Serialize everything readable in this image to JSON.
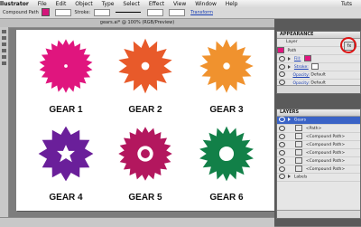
{
  "menubar": {
    "app": "llustrator",
    "items": [
      "File",
      "Edit",
      "Object",
      "Type",
      "Select",
      "Effect",
      "View",
      "Window",
      "Help"
    ],
    "right": "Tuts"
  },
  "control_bar": {
    "selection": "Compound Path",
    "stroke_label": "Stroke:",
    "extra_link": "Transform",
    "fill_color": "#d4147a"
  },
  "document": {
    "tab_title": "gears.ai* @ 100% (RGB/Preview)"
  },
  "gears": [
    {
      "label": "GEAR 1",
      "color": "#e0157e"
    },
    {
      "label": "GEAR 2",
      "color": "#e85a2a"
    },
    {
      "label": "GEAR 3",
      "color": "#f0922e"
    },
    {
      "label": "GEAR 4",
      "color": "#6a1f9a"
    },
    {
      "label": "GEAR 5",
      "color": "#b3175e"
    },
    {
      "label": "GEAR 6",
      "color": "#128048"
    }
  ],
  "appearance_panel": {
    "title": "APPEARANCE",
    "header": "Layer",
    "rows": [
      {
        "label": "Path"
      },
      {
        "label": "Fill:"
      },
      {
        "label": "Stroke:"
      },
      {
        "label": "Opacity:",
        "value": "Default"
      },
      {
        "label": "Opacity:",
        "value": "Default"
      }
    ],
    "fx_label": "fx"
  },
  "layers_panel": {
    "title": "LAYERS",
    "rows": [
      {
        "label": "Gears",
        "selected": true
      },
      {
        "label": "<Path>"
      },
      {
        "label": "<Compound Path>"
      },
      {
        "label": "<Compound Path>"
      },
      {
        "label": "<Compound Path>"
      },
      {
        "label": "<Compound Path>"
      },
      {
        "label": "<Compound Path>"
      },
      {
        "label": "Labels"
      }
    ]
  }
}
